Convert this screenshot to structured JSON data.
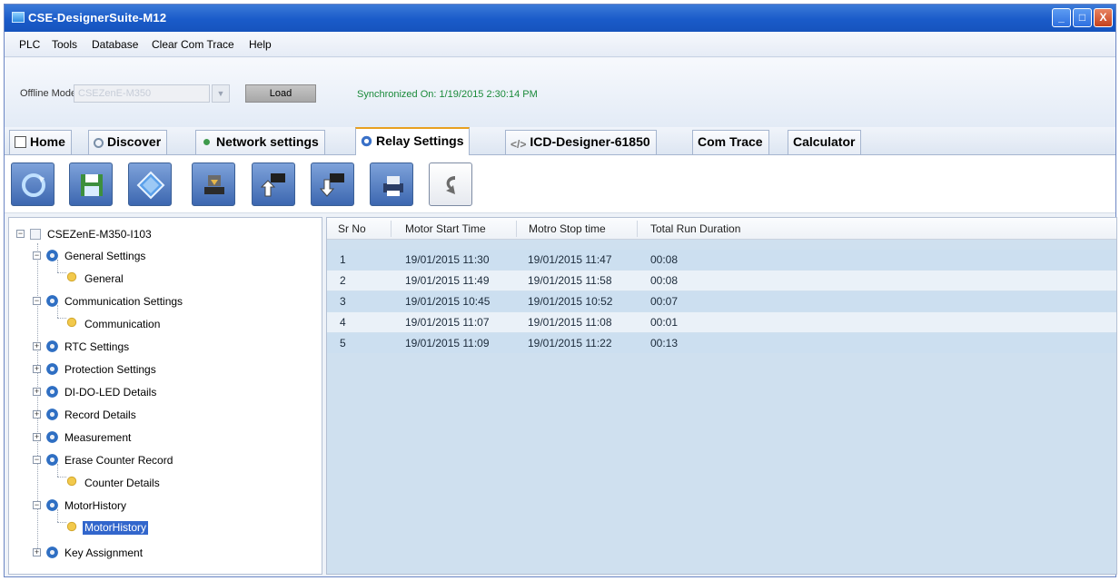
{
  "window": {
    "title": "CSE-DesignerSuite-M12",
    "controls": {
      "minimize": "_",
      "maximize": "□",
      "close": "X"
    }
  },
  "menu": [
    "PLC",
    "Tools",
    "Database",
    "Clear Com Trace",
    "Help"
  ],
  "offline": {
    "label": "Offline Mode :",
    "selected": "CSEZenE-M350",
    "load_label": "Load",
    "sync_status": "Synchronized On: 1/19/2015 2:30:14 PM"
  },
  "tabs": [
    {
      "label": "Home",
      "icon": "home-icon"
    },
    {
      "label": "Discover",
      "icon": "search-icon"
    },
    {
      "label": "Network settings",
      "icon": "network-icon"
    },
    {
      "label": "Relay Settings",
      "icon": "gear-icon",
      "active": true
    },
    {
      "label": "ICD-Designer-61850",
      "icon": "code-icon"
    },
    {
      "label": "Com Trace",
      "icon": ""
    },
    {
      "label": "Calculator",
      "icon": ""
    }
  ],
  "toolbar": [
    "refresh-icon",
    "save-icon",
    "diamond-icon",
    "download-icon",
    "upload-device-icon",
    "download-device-icon",
    "print-icon",
    "undo-icon"
  ],
  "tree": {
    "root": "CSEZenE-M350-I103",
    "nodes": [
      {
        "label": "General Settings",
        "expanded": true,
        "children": [
          "General"
        ]
      },
      {
        "label": "Communication Settings",
        "expanded": true,
        "children": [
          "Communication"
        ]
      },
      {
        "label": "RTC Settings",
        "expanded": false,
        "children": []
      },
      {
        "label": "Protection Settings",
        "expanded": false,
        "children": []
      },
      {
        "label": "DI-DO-LED Details",
        "expanded": false,
        "children": []
      },
      {
        "label": "Record Details",
        "expanded": false,
        "children": []
      },
      {
        "label": "Measurement",
        "expanded": false,
        "children": []
      },
      {
        "label": "Erase Counter Record",
        "expanded": true,
        "children": [
          "Counter Details"
        ]
      },
      {
        "label": "MotorHistory",
        "expanded": true,
        "children": [
          "MotorHistory"
        ]
      },
      {
        "label": "Key Assignment",
        "expanded": false,
        "children": []
      }
    ],
    "selected": "MotorHistory"
  },
  "grid": {
    "columns": [
      "Sr No",
      "Motor Start Time",
      "Motro Stop time",
      "Total Run Duration"
    ],
    "rows": [
      [
        "1",
        "19/01/2015 11:30",
        "19/01/2015 11:47",
        "00:08"
      ],
      [
        "2",
        "19/01/2015 11:49",
        "19/01/2015 11:58",
        "00:08"
      ],
      [
        "3",
        "19/01/2015 10:45",
        "19/01/2015 10:52",
        "00:07"
      ],
      [
        "4",
        "19/01/2015 11:07",
        "19/01/2015 11:08",
        "00:01"
      ],
      [
        "5",
        "19/01/2015 11:09",
        "19/01/2015 11:22",
        "00:13"
      ]
    ]
  },
  "colors": {
    "title_bar": "#1a5bc9",
    "active_tab_accent": "#e8a020",
    "grid_row": "#ccdff0",
    "selection": "#3266cc",
    "status_text": "#1a8a3a"
  }
}
